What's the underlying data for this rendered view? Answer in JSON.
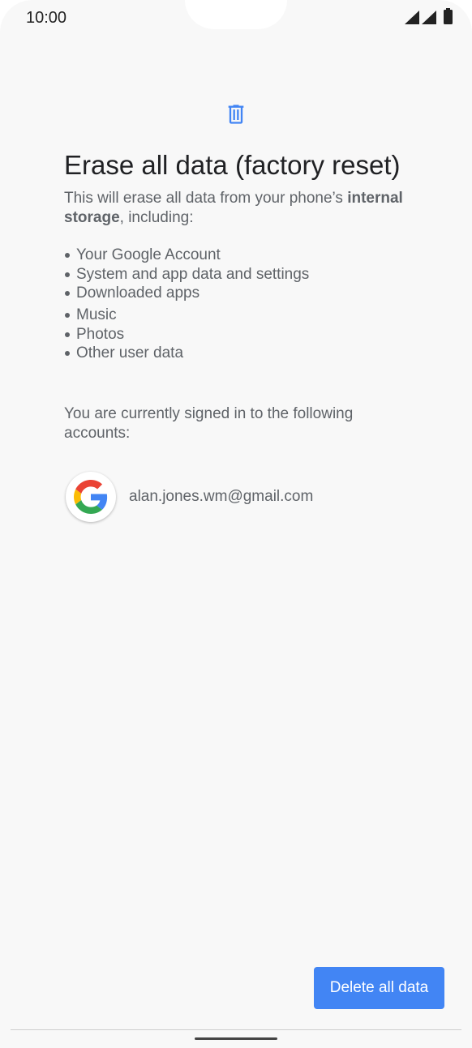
{
  "status_bar": {
    "time": "10:00",
    "icons": [
      "signal-icon",
      "signal-icon",
      "battery-icon"
    ]
  },
  "header": {
    "icon": "trash-icon",
    "accent_color": "#4285f4",
    "title": "Erase all data (factory reset)"
  },
  "description": {
    "prefix": "This will erase all data from your phone’s ",
    "bold": "internal storage",
    "suffix": ", including:"
  },
  "items": [
    "Your Google Account",
    "System and app data and settings",
    "Downloaded apps",
    "Music",
    "Photos",
    "Other user data"
  ],
  "accounts": {
    "intro": "You are currently signed in to the following accounts:",
    "list": [
      {
        "icon": "google-icon",
        "email": "alan.jones.wm@gmail.com"
      }
    ]
  },
  "actions": {
    "delete_label": "Delete all data",
    "button_color": "#4285f4"
  }
}
